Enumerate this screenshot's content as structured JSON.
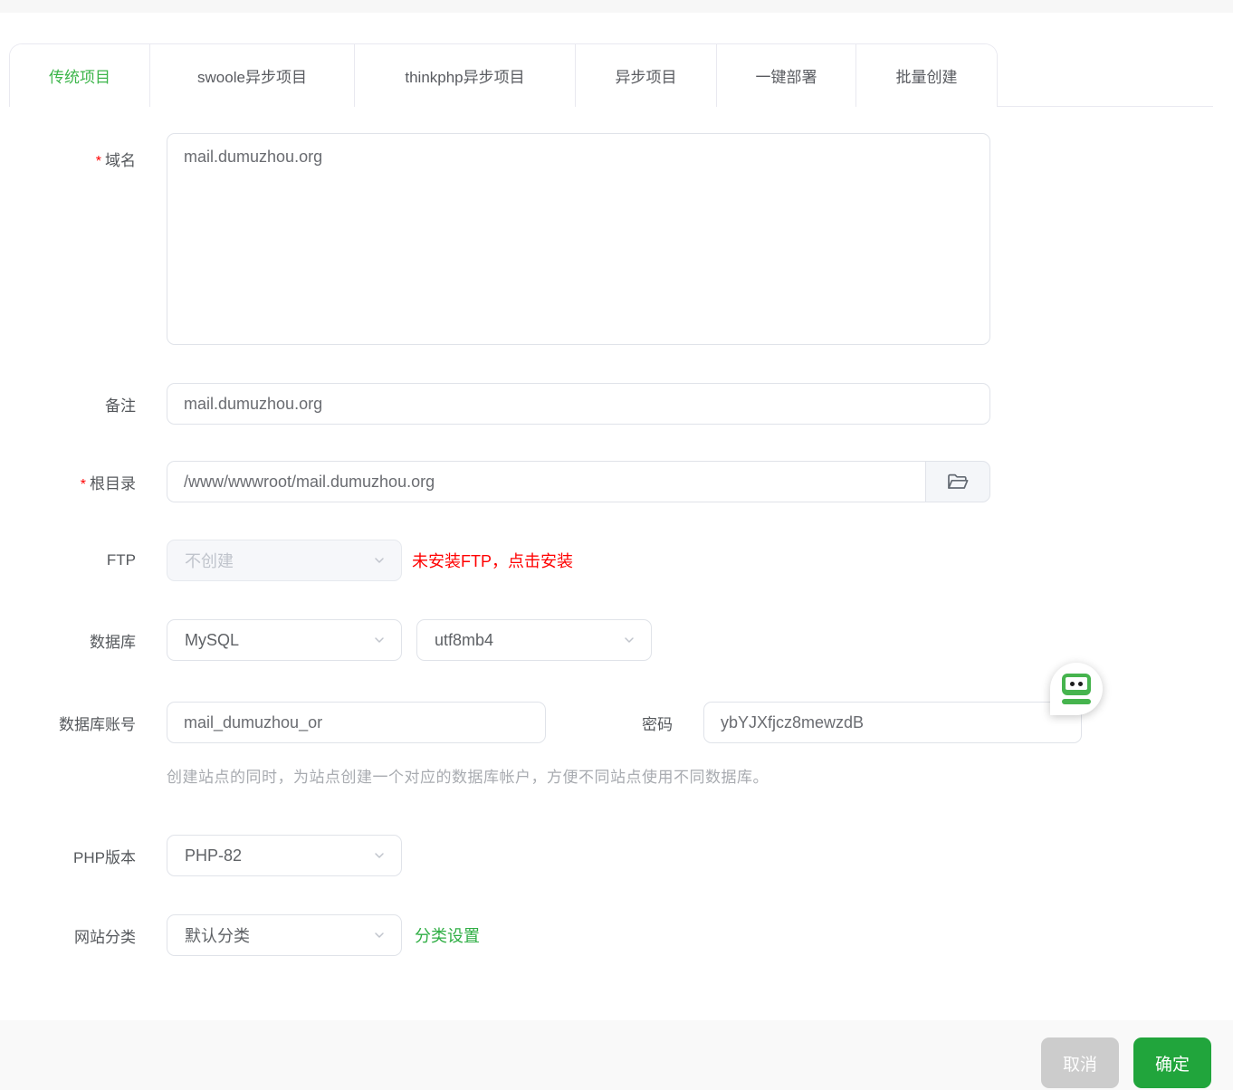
{
  "colors": {
    "accent_green": "#21a53c",
    "tab_active_green": "#3cb54a",
    "link_green": "#2fae44",
    "warning_red": "#ff0000",
    "disabled_bg": "#f6f7fa"
  },
  "tabs": {
    "items": [
      {
        "label": "传统项目",
        "active": true
      },
      {
        "label": "swoole异步项目",
        "active": false
      },
      {
        "label": "thinkphp异步项目",
        "active": false
      },
      {
        "label": "异步项目",
        "active": false
      },
      {
        "label": "一键部署",
        "active": false
      },
      {
        "label": "批量创建",
        "active": false
      }
    ]
  },
  "form": {
    "required_mark": "*",
    "domain": {
      "label": "域名",
      "required": "*",
      "value": "mail.dumuzhou.org"
    },
    "note": {
      "label": "备注",
      "value": "mail.dumuzhou.org"
    },
    "root": {
      "label": "根目录",
      "required": "*",
      "value": "/www/wwwroot/mail.dumuzhou.org"
    },
    "ftp": {
      "label": "FTP",
      "value": "不创建",
      "warning": "未安装FTP，点击安装"
    },
    "database": {
      "label": "数据库",
      "type_value": "MySQL",
      "charset_value": "utf8mb4"
    },
    "db_account": {
      "label": "数据库账号",
      "value": "mail_dumuzhou_or",
      "password_label": "密码",
      "password_value": "ybYJXfjcz8mewzdB",
      "hint": "创建站点的同时，为站点创建一个对应的数据库帐户，方便不同站点使用不同数据库。"
    },
    "php": {
      "label": "PHP版本",
      "value": "PHP-82"
    },
    "category": {
      "label": "网站分类",
      "value": "默认分类",
      "link": "分类设置"
    }
  },
  "footer": {
    "cancel": "取消",
    "confirm": "确定"
  }
}
